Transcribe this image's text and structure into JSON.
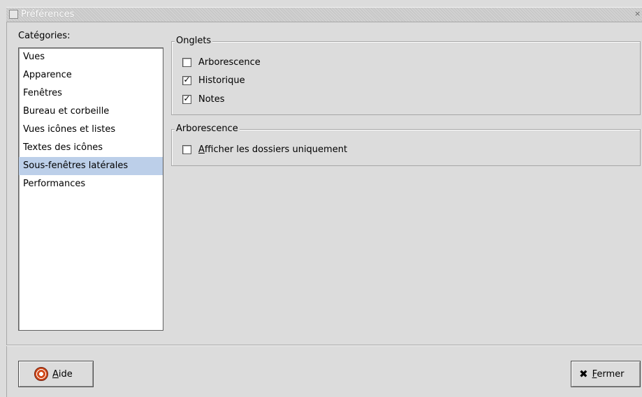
{
  "window": {
    "title": "Préférences",
    "close_glyph": "×"
  },
  "categories": {
    "label": "Catégories:",
    "items": [
      {
        "label": "Vues"
      },
      {
        "label": "Apparence"
      },
      {
        "label": "Fenêtres"
      },
      {
        "label": "Bureau et corbeille"
      },
      {
        "label": "Vues icônes et listes"
      },
      {
        "label": "Textes des icônes"
      },
      {
        "label": "Sous-fenêtres latérales",
        "selected": true
      },
      {
        "label": "Performances"
      }
    ]
  },
  "onglets": {
    "title": "Onglets",
    "options": [
      {
        "label": "Arborescence",
        "checked": false
      },
      {
        "label": "Historique",
        "checked": true
      },
      {
        "label": "Notes",
        "checked": true
      }
    ]
  },
  "arborescence": {
    "title": "Arborescence",
    "options": [
      {
        "label": "Afficher les dossiers uniquement",
        "checked": false
      }
    ]
  },
  "buttons": {
    "help_label": "Aide",
    "close_label": "Fermer"
  },
  "icons": {
    "help": "lifebuoy-icon",
    "close": "x-icon",
    "window": "window-menu-icon"
  },
  "colors": {
    "background": "#dcdcdc",
    "selection": "#bccfe9"
  }
}
